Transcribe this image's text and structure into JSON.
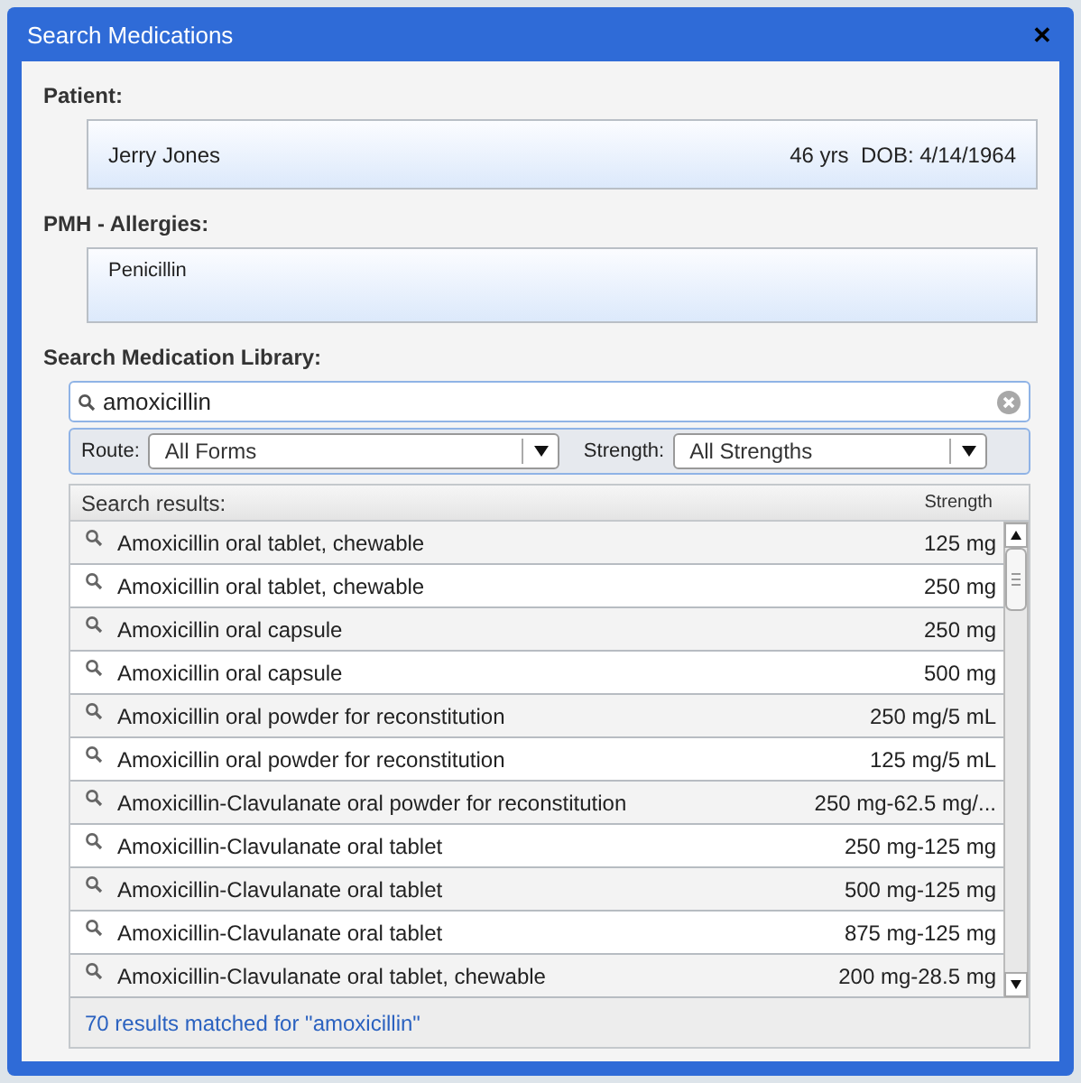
{
  "window": {
    "title": "Search Medications",
    "close": "✕"
  },
  "patient": {
    "label": "Patient:",
    "name": "Jerry Jones",
    "age": "46 yrs",
    "dob": "DOB: 4/14/1964"
  },
  "allergies": {
    "label": "PMH - Allergies:",
    "text": "Penicillin"
  },
  "search": {
    "label": "Search Medication Library:",
    "value": "amoxicillin"
  },
  "filters": [
    {
      "label": "Route:",
      "value": "All Forms"
    },
    {
      "label": "Strength:",
      "value": "All Strengths"
    }
  ],
  "results": {
    "columns": [
      "Search results:",
      "Strength"
    ],
    "rows": [
      {
        "name": "Amoxicillin oral tablet, chewable",
        "strength": "125 mg"
      },
      {
        "name": "Amoxicillin oral tablet, chewable",
        "strength": "250 mg"
      },
      {
        "name": "Amoxicillin oral capsule",
        "strength": "250 mg"
      },
      {
        "name": "Amoxicillin oral capsule",
        "strength": "500 mg"
      },
      {
        "name": "Amoxicillin oral powder for reconstitution",
        "strength": "250 mg/5 mL"
      },
      {
        "name": "Amoxicillin oral powder for reconstitution",
        "strength": "125 mg/5 mL"
      },
      {
        "name": "Amoxicillin-Clavulanate oral powder for reconstitution",
        "strength": "250 mg-62.5 mg/..."
      },
      {
        "name": "Amoxicillin-Clavulanate oral tablet",
        "strength": "250 mg-125 mg"
      },
      {
        "name": "Amoxicillin-Clavulanate oral tablet",
        "strength": "500 mg-125 mg"
      },
      {
        "name": "Amoxicillin-Clavulanate oral tablet",
        "strength": "875 mg-125 mg"
      },
      {
        "name": "Amoxicillin-Clavulanate oral tablet, chewable",
        "strength": "200 mg-28.5 mg"
      }
    ],
    "summary": "70 results matched for \"amoxicillin\""
  }
}
